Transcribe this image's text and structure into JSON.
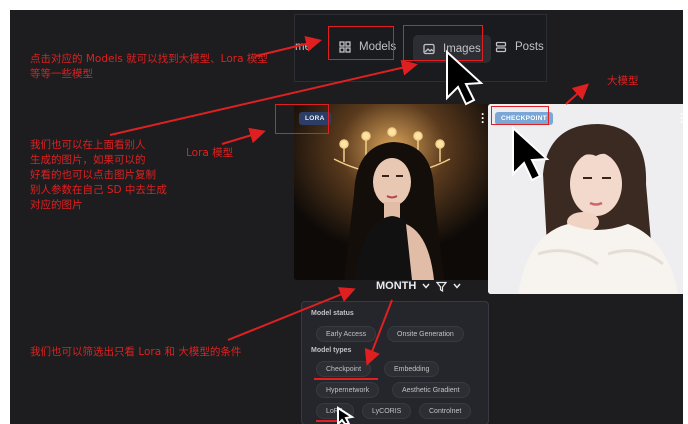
{
  "nav": {
    "home_label": "me",
    "models_label": "Models",
    "images_label": "Images",
    "posts_label": "Posts"
  },
  "cards": {
    "lora_badge": "LORA",
    "checkpoint_badge": "CHECKPOINT"
  },
  "filter": {
    "period_label": "MONTH",
    "model_status_title": "Model status",
    "status_options": [
      "Early Access",
      "Onsite Generation"
    ],
    "model_types_title": "Model types",
    "type_options": [
      "Checkpoint",
      "Embedding",
      "Hypernetwork",
      "Aesthetic Gradient",
      "LoRA",
      "LyCORIS",
      "Controlnet"
    ]
  },
  "annotations": {
    "models_note_line1": "点击对应的 Models 就可以找到大模型、Lora 模型",
    "models_note_line2": "等等一些模型",
    "big_model": "大模型",
    "images_note": [
      "我们也可以在上面看别人",
      "生成的图片，如果可以的",
      "好看的也可以点击图片复制",
      "别人参数在自己 SD 中去生成",
      "对应的图片"
    ],
    "lora_model": "Lora 模型",
    "filter_note": "我们也可以筛选出只看 Lora 和 大模型的条件"
  },
  "colors": {
    "annotation": "#e02020",
    "background": "#1d1d1f",
    "panel": "#25262b"
  }
}
